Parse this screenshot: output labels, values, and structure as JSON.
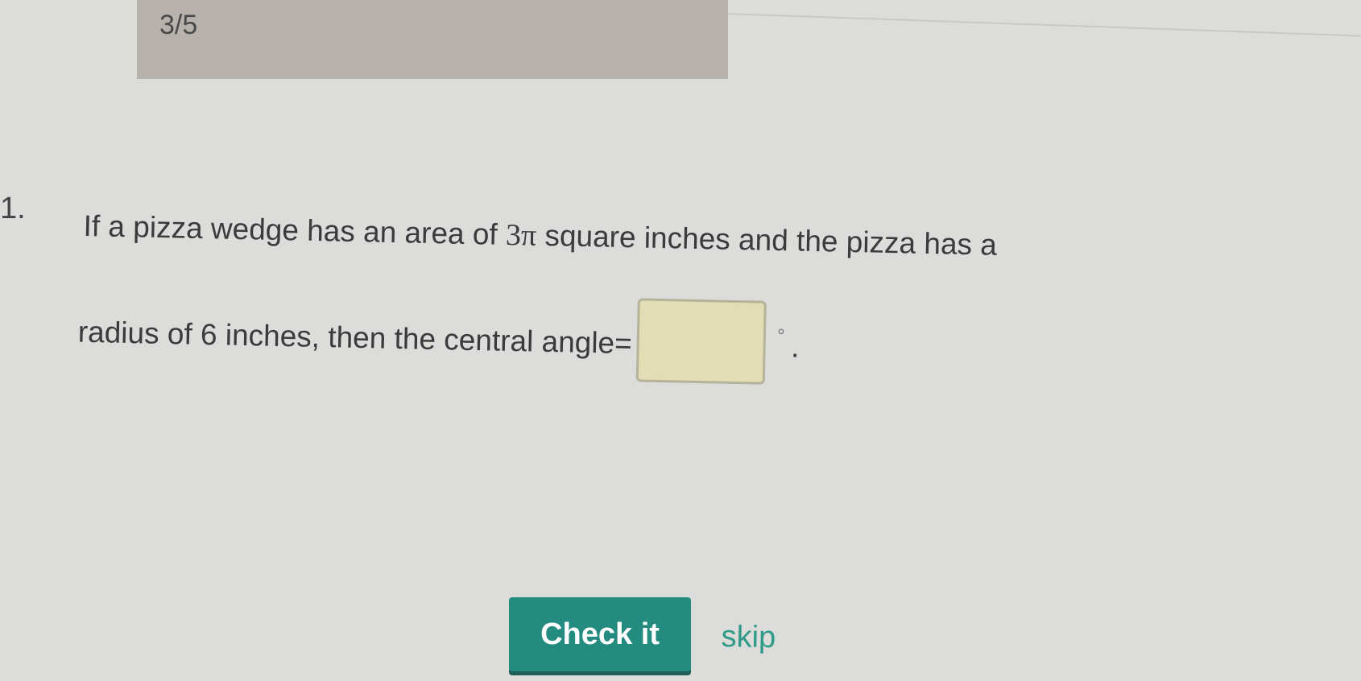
{
  "progress": {
    "label": "3/5"
  },
  "question": {
    "number": "1.",
    "line1_before": "If a pizza wedge has an area of ",
    "line1_math": "3π",
    "line1_after": " square inches and the pizza has a",
    "line2_before": "radius of 6 inches, then the central angle=",
    "answer_value": "",
    "degree_symbol": "°",
    "period": "."
  },
  "actions": {
    "check_label": "Check it",
    "skip_label": "skip"
  },
  "colors": {
    "background": "#dcdcda",
    "progress_bar": "#b7b3ac",
    "answer_box_fill": "#e2ddb4",
    "button": "#238b80",
    "link": "#2e9a87"
  }
}
